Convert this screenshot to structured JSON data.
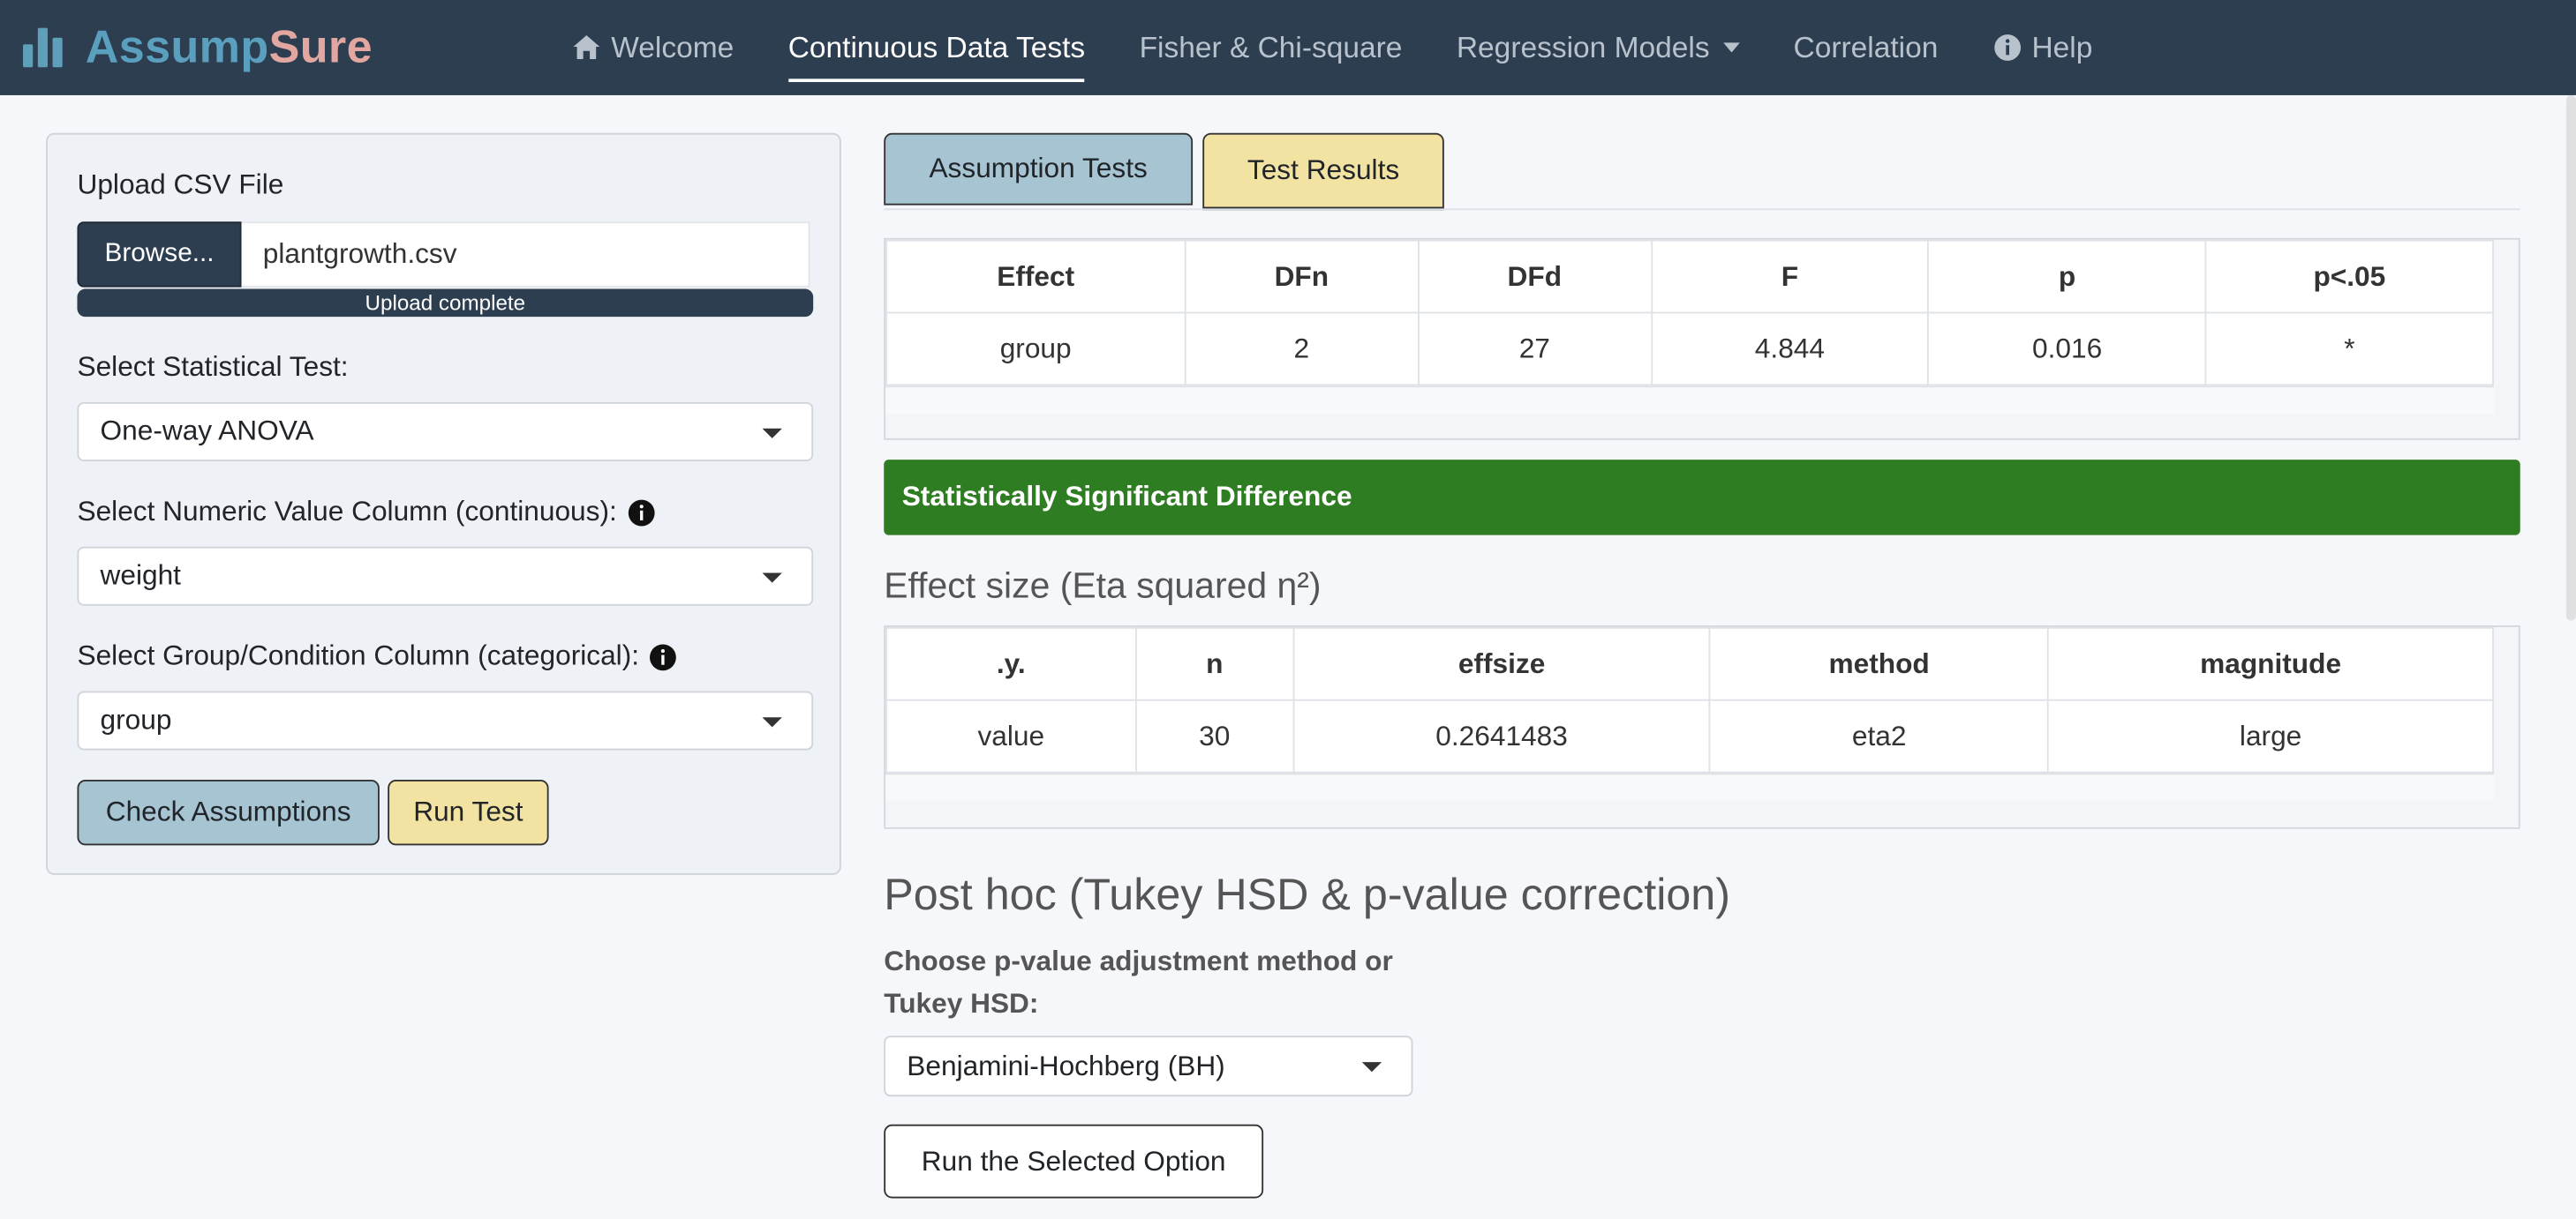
{
  "brand": {
    "name_part1": "Assump",
    "name_part2": "Sure",
    "icon": "bar-chart-icon"
  },
  "nav": {
    "items": [
      {
        "label": "Welcome",
        "icon": "home-icon"
      },
      {
        "label": "Continuous Data Tests",
        "active": true
      },
      {
        "label": "Fisher & Chi-square"
      },
      {
        "label": "Regression Models",
        "dropdown": true
      },
      {
        "label": "Correlation"
      },
      {
        "label": "Help",
        "icon": "info-circle-icon"
      }
    ]
  },
  "sidebar": {
    "upload_label": "Upload CSV File",
    "browse_label": "Browse...",
    "file_name": "plantgrowth.csv",
    "progress_text": "Upload complete",
    "progress_fraction": 1.0,
    "test_label": "Select Statistical Test:",
    "test_value": "One-way ANOVA",
    "numeric_label": "Select Numeric Value Column (continuous):",
    "numeric_value": "weight",
    "group_label": "Select Group/Condition Column (categorical):",
    "group_value": "group",
    "check_btn": "Check Assumptions",
    "run_btn": "Run Test"
  },
  "tabs": {
    "assumption": "Assumption Tests",
    "results": "Test Results"
  },
  "anova_table": {
    "headers": [
      "Effect",
      "DFn",
      "DFd",
      "F",
      "p",
      "p<.05"
    ],
    "rows": [
      [
        "group",
        "2",
        "27",
        "4.844",
        "0.016",
        "*"
      ]
    ]
  },
  "alert_text": "Statistically Significant Difference",
  "effect_size": {
    "heading": "Effect size (Eta squared η²)",
    "headers": [
      ".y.",
      "n",
      "effsize",
      "method",
      "magnitude"
    ],
    "rows": [
      [
        "value",
        "30",
        "0.2641483",
        "eta2",
        "large"
      ]
    ]
  },
  "posthoc": {
    "heading": "Post hoc (Tukey HSD & p-value correction)",
    "label": "Choose p-value adjustment method or Tukey HSD:",
    "selected": "Benjamini-Hochberg (BH)",
    "run_btn": "Run the Selected Option"
  },
  "colors": {
    "navbar": "#2c3e50",
    "brand_blue": "#5aa0be",
    "brand_pink": "#e2a7a0",
    "assumption_btn": "#a6c4d2",
    "run_btn": "#f2e3a3",
    "alert_green": "#2f7d22"
  }
}
